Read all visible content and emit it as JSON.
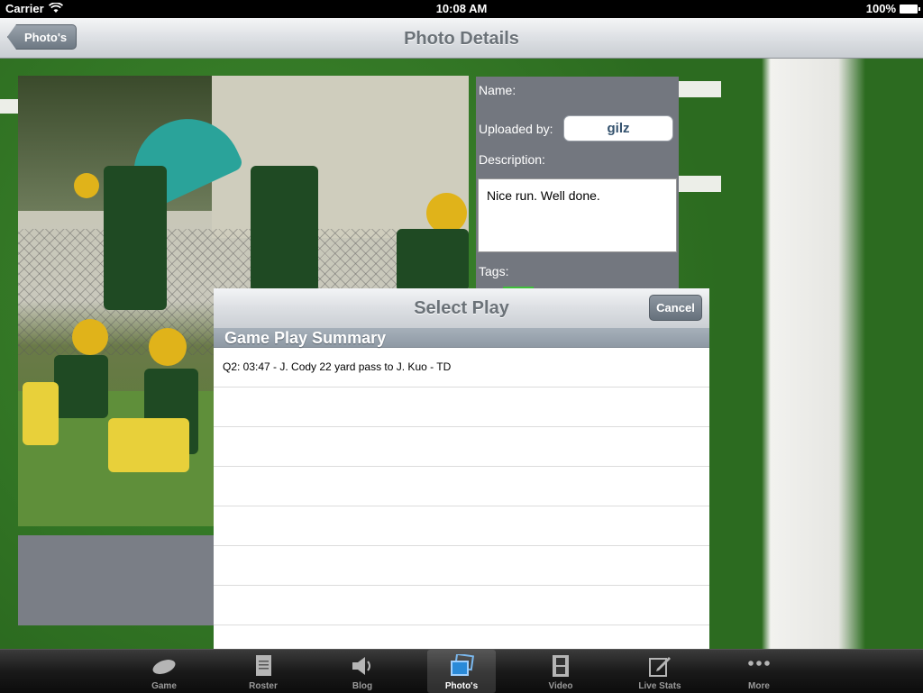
{
  "status_bar": {
    "carrier": "Carrier",
    "time": "10:08 AM",
    "battery": "100%"
  },
  "nav_bar": {
    "title": "Photo Details",
    "back_label": "Photo's"
  },
  "details": {
    "name_label": "Name:",
    "uploaded_by_label": "Uploaded by:",
    "uploaded_by_value": "gilz",
    "description_label": "Description:",
    "description_value": "Nice run. Well done.",
    "tags_label": "Tags:"
  },
  "select_play": {
    "title": "Select Play",
    "cancel_label": "Cancel",
    "section_header": "Game Play Summary",
    "rows": [
      "Q2: 03:47 - J. Cody 22 yard pass to  J. Kuo - TD",
      "",
      "",
      "",
      "",
      "",
      "",
      ""
    ]
  },
  "tab_bar": {
    "tabs": [
      {
        "label": "Game",
        "icon": "football-icon",
        "active": false
      },
      {
        "label": "Roster",
        "icon": "document-icon",
        "active": false
      },
      {
        "label": "Blog",
        "icon": "speaker-icon",
        "active": false
      },
      {
        "label": "Photo's",
        "icon": "photos-icon",
        "active": true
      },
      {
        "label": "Video",
        "icon": "film-icon",
        "active": false
      },
      {
        "label": "Live Stats",
        "icon": "compose-icon",
        "active": false
      },
      {
        "label": "More",
        "icon": "more-icon",
        "active": false
      }
    ]
  },
  "colors": {
    "accent_blue": "#2a8ad8",
    "panel_gray": "#73777f",
    "field_green": "#2f7324"
  }
}
